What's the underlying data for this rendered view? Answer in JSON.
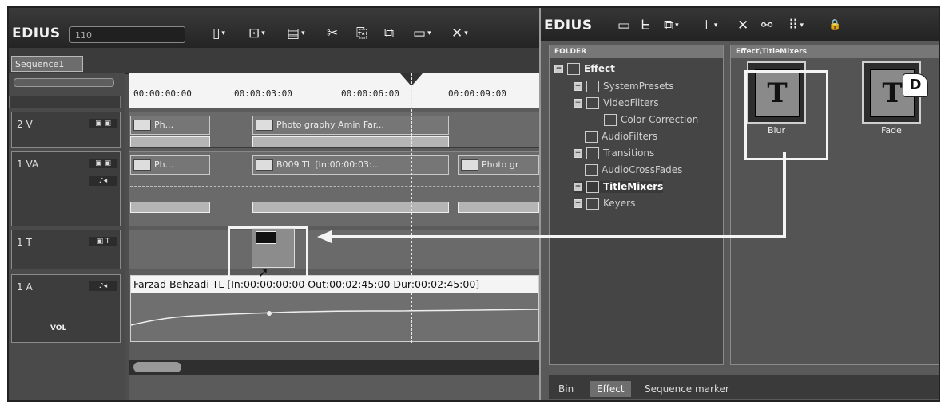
{
  "timeline_window": {
    "brand": "EDIUS",
    "project_field": "110",
    "toolbar": [
      {
        "icon": "new-project-icon",
        "glyph": "▯"
      },
      {
        "icon": "open-project-icon",
        "glyph": "⊡"
      },
      {
        "icon": "save-icon",
        "glyph": "▤"
      },
      {
        "icon": "cut-icon",
        "glyph": "✂"
      },
      {
        "icon": "copy-icon",
        "glyph": "⎘"
      },
      {
        "icon": "paste-icon",
        "glyph": "⧉"
      },
      {
        "icon": "mode-icon",
        "glyph": "▭"
      },
      {
        "icon": "delete-icon",
        "glyph": "✕"
      }
    ],
    "sequence_tab": "Sequence1",
    "ruler_ticks": [
      "00:00:00:00",
      "00:00:03:00",
      "00:00:06:00",
      "00:00:09:00"
    ],
    "tracks": {
      "v2": {
        "label": "2 V",
        "clips": [
          "Ph...",
          "Photo graphy  Amin Far..."
        ]
      },
      "va1": {
        "label": "1 VA",
        "clips": [
          "Ph...",
          "B009  TL [In:00:00:03:...",
          "Photo gr"
        ]
      },
      "t1": {
        "label": "1 T"
      },
      "a1": {
        "label": "1 A",
        "clip_info": "Farzad Behzadi  TL [In:00:00:00:00 Out:00:02:45:00 Dur:00:02:45:00]",
        "vol_label": "VOL"
      }
    }
  },
  "effects_window": {
    "brand": "EDIUS",
    "toolbar": [
      {
        "icon": "bin-icon",
        "glyph": "▭"
      },
      {
        "icon": "up-icon",
        "glyph": "ᖶ"
      },
      {
        "icon": "copy-icon",
        "glyph": "⧉"
      },
      {
        "icon": "line-icon",
        "glyph": "⊥"
      },
      {
        "icon": "delete-icon",
        "glyph": "✕"
      },
      {
        "icon": "search-icon",
        "glyph": "⚯"
      },
      {
        "icon": "view-icon",
        "glyph": "⠿"
      },
      {
        "icon": "lock-icon",
        "glyph": "🔒"
      }
    ],
    "folder_header": "FOLDER",
    "tree": [
      {
        "label": "Effect",
        "pm": "−",
        "indent": 0
      },
      {
        "label": "SystemPresets",
        "pm": "+",
        "indent": 1
      },
      {
        "label": "VideoFilters",
        "pm": "−",
        "indent": 1
      },
      {
        "label": "Color Correction",
        "pm": "",
        "indent": 2
      },
      {
        "label": "AudioFilters",
        "pm": "",
        "indent": 1
      },
      {
        "label": "Transitions",
        "pm": "+",
        "indent": 1
      },
      {
        "label": "AudioCrossFades",
        "pm": "",
        "indent": 1
      },
      {
        "label": "TitleMixers",
        "pm": "+",
        "indent": 1,
        "selected": true
      },
      {
        "label": "Keyers",
        "pm": "+",
        "indent": 1
      }
    ],
    "content_header": "Effect\\TitleMixers",
    "effects": [
      {
        "name": "Blur",
        "glyph": "T"
      },
      {
        "name": "Fade",
        "glyph": "T"
      }
    ],
    "default_badge": "D",
    "bottom_tabs": [
      "Bin",
      "Effect",
      "Sequence marker"
    ],
    "active_tab": "Effect"
  }
}
